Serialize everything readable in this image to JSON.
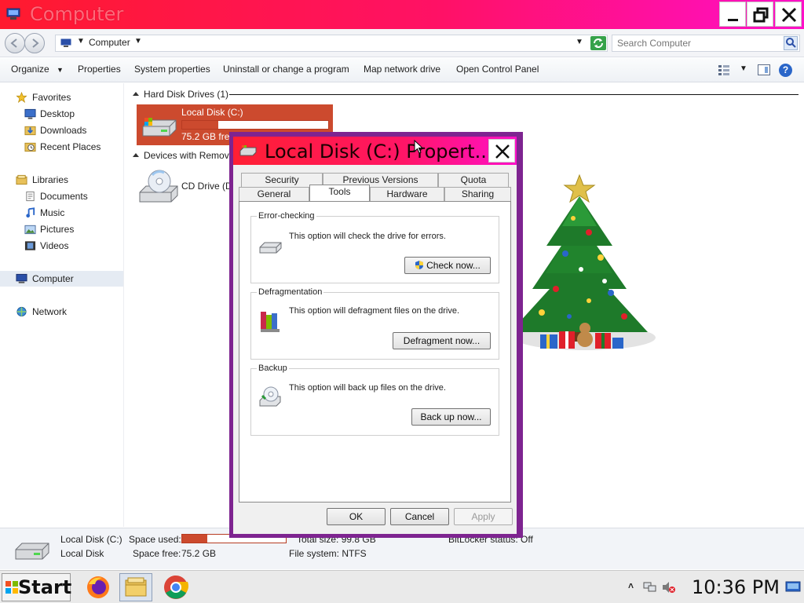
{
  "window": {
    "title": "Computer",
    "icon": "computer-icon"
  },
  "address": {
    "path": "Computer",
    "search_placeholder": "Search Computer"
  },
  "commands": {
    "organize": "Organize",
    "properties": "Properties",
    "system_properties": "System properties",
    "uninstall": "Uninstall or change a program",
    "map_drive": "Map network drive",
    "control_panel": "Open Control Panel"
  },
  "nav": {
    "favorites": "Favorites",
    "desktop": "Desktop",
    "downloads": "Downloads",
    "recent_places": "Recent Places",
    "libraries": "Libraries",
    "documents": "Documents",
    "music": "Music",
    "pictures": "Pictures",
    "videos": "Videos",
    "computer": "Computer",
    "network": "Network"
  },
  "content": {
    "hdd_group": "Hard Disk Drives (1)",
    "removable_group": "Devices with Removable Storage",
    "local_disk": {
      "name": "Local Disk (C:)",
      "free": "75.2 GB free of 99.8 GB",
      "used_fraction": 0.246,
      "color": "#cc4a2e"
    },
    "cd_drive": {
      "name": "CD Drive (D:)"
    }
  },
  "details": {
    "name": "Local Disk (C:)",
    "type": "Local Disk",
    "space_used_label": "Space used:",
    "space_free_label": "Space free:",
    "space_free": "75.2 GB",
    "total_size": "Total size: 99.8 GB",
    "file_system": "File system: NTFS",
    "bitlocker": "BitLocker status: Off"
  },
  "dialog": {
    "title": "Local Disk (C:) Propert...",
    "tabs_row1": [
      "Security",
      "Previous Versions",
      "Quota"
    ],
    "tabs_row2": [
      "General",
      "Tools",
      "Hardware",
      "Sharing"
    ],
    "active_tab": "Tools",
    "error_checking": {
      "legend": "Error-checking",
      "text": "This option will check the drive for errors.",
      "button": "Check now..."
    },
    "defrag": {
      "legend": "Defragmentation",
      "text": "This option will defragment files on the drive.",
      "button": "Defragment now..."
    },
    "backup": {
      "legend": "Backup",
      "text": "This option will back up files on the drive.",
      "button": "Back up now..."
    },
    "ok": "OK",
    "cancel": "Cancel",
    "apply": "Apply"
  },
  "taskbar": {
    "start": "Start",
    "apps": [
      "firefox-icon",
      "explorer-icon",
      "chrome-icon"
    ],
    "clock": "10:36 PM"
  }
}
